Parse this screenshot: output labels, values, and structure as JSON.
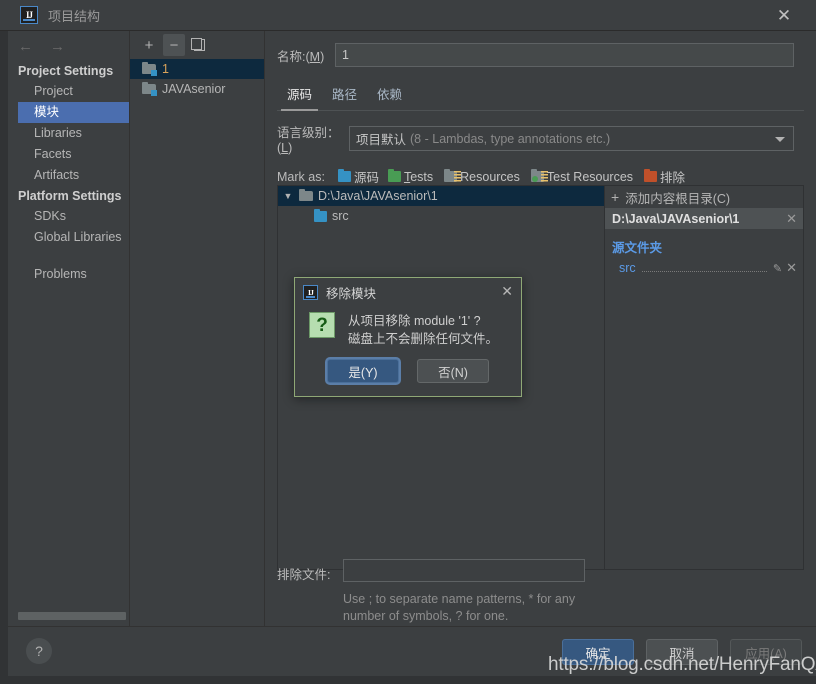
{
  "window": {
    "title": "项目结构",
    "logo_text": "IJ",
    "close_icon": "✕"
  },
  "sidebar": {
    "back_icon": "←",
    "forward_icon": "→",
    "groups": [
      {
        "label": "Project Settings",
        "items": [
          {
            "label": "Project",
            "selected": false
          },
          {
            "label": "模块",
            "selected": true
          },
          {
            "label": "Libraries",
            "selected": false
          },
          {
            "label": "Facets",
            "selected": false
          },
          {
            "label": "Artifacts",
            "selected": false
          }
        ]
      },
      {
        "label": "Platform Settings",
        "items": [
          {
            "label": "SDKs",
            "selected": false
          },
          {
            "label": "Global Libraries",
            "selected": false
          }
        ]
      }
    ],
    "problems_label": "Problems"
  },
  "modules_panel": {
    "toolbar": {
      "add_label": "+",
      "remove_label": "−",
      "copy_label": "copy"
    },
    "items": [
      {
        "label": "1",
        "selected": true
      },
      {
        "label": "JAVAsenior",
        "selected": false
      }
    ]
  },
  "main": {
    "name_label": "名称:(M)",
    "name_value": "1",
    "name_placeholder": "",
    "tabs": [
      {
        "label": "源码",
        "active": true
      },
      {
        "label": "路径",
        "active": false
      },
      {
        "label": "依赖",
        "active": false
      }
    ],
    "language_level": {
      "label": "语言级别：(L)",
      "value_main": "项目默认",
      "value_sub": "(8 - Lambdas, type annotations etc.)"
    },
    "mark_as": {
      "label": "Mark as:",
      "options": [
        {
          "label": "源码",
          "icon": "folder-blue-icon"
        },
        {
          "label": "Tests",
          "icon": "folder-green-icon"
        },
        {
          "label": "Resources",
          "icon": "folder-resources-icon"
        },
        {
          "label": "Test Resources",
          "icon": "folder-test-resources-icon"
        },
        {
          "label": "排除",
          "icon": "folder-orange-icon"
        }
      ]
    },
    "tree": {
      "twisty_icon": "▼",
      "rows": [
        {
          "label": "D:\\Java\\JAVAsenior\\1",
          "selected": true,
          "depth": 0
        },
        {
          "label": "src",
          "selected": false,
          "depth": 1
        }
      ]
    },
    "content_roots": {
      "add_label": "添加内容根目录(C)",
      "add_icon": "+",
      "root_path": "D:\\Java\\JAVAsenior\\1",
      "root_close_icon": "✕",
      "source_group_label": "源文件夹",
      "source_folders": [
        {
          "label": "src",
          "edit_icon": "✎",
          "remove_icon": "✕"
        }
      ]
    },
    "exclude": {
      "label": "排除文件:",
      "value": "",
      "placeholder": "",
      "hint": "Use ; to separate name patterns, * for any number of symbols, ? for one."
    }
  },
  "bottom": {
    "help_icon": "?",
    "buttons": [
      {
        "label": "确定",
        "style": "primary"
      },
      {
        "label": "取消",
        "style": "normal"
      },
      {
        "label": "应用(A)",
        "style": "disabled"
      }
    ]
  },
  "modal": {
    "logo_text": "IJ",
    "title": "移除模块",
    "close_icon": "✕",
    "question_icon": "?",
    "message_line1": "从项目移除 module '1' ?",
    "message_line2": "磁盘上不会删除任何文件。",
    "buttons": [
      {
        "label": "是(Y)",
        "style": "yes"
      },
      {
        "label": "否(N)",
        "style": "no"
      }
    ]
  },
  "watermark": {
    "text": "https://blog.csdn.net/HenryFanQAQ"
  },
  "colors": {
    "background": "#3c3f41",
    "selection_blue": "#4b6eaf",
    "tree_selection": "#0d293e",
    "accent_link": "#5b9ae6",
    "module_selected_text": "#d9a35b",
    "modal_border": "#8fa876",
    "primary_button": "#365880"
  }
}
